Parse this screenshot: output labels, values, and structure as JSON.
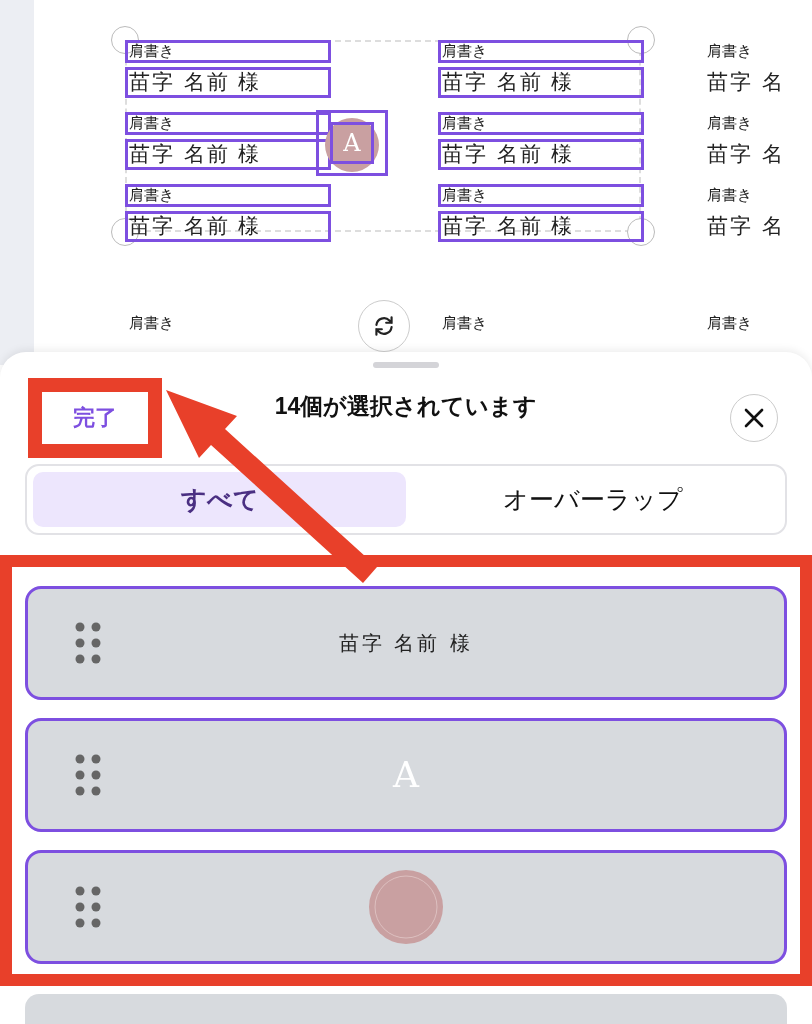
{
  "canvas": {
    "columns": [
      {
        "items": [
          {
            "title": "肩書き",
            "name": "苗字 名前 様",
            "selected": true
          },
          {
            "title": "肩書き",
            "name": "苗字 名前 様",
            "selected": true
          },
          {
            "title": "肩書き",
            "name": "苗字 名前 様",
            "selected": true
          },
          {
            "title": "肩書き",
            "selected": false
          }
        ]
      },
      {
        "items": [
          {
            "title": "肩書き",
            "name": "苗字 名前 様",
            "selected": true
          },
          {
            "title": "肩書き",
            "name": "苗字 名前 様",
            "selected": true
          },
          {
            "title": "肩書き",
            "name": "苗字 名前 様",
            "selected": true
          },
          {
            "title": "肩書き",
            "selected": false
          }
        ]
      },
      {
        "items": [
          {
            "title": "肩書き",
            "name": "苗字 名",
            "selected": false
          },
          {
            "title": "肩書き",
            "name": "苗字 名",
            "selected": false
          },
          {
            "title": "肩書き",
            "name": "苗字 名",
            "selected": false
          },
          {
            "title": "肩書き",
            "selected": false
          }
        ]
      }
    ],
    "emblem": {
      "letter": "A",
      "selected": true
    }
  },
  "sheet": {
    "done": "完了",
    "title": "14個が選択されています",
    "tabs": [
      {
        "label": "すべて",
        "selected": true
      },
      {
        "label": "オーバーラップ",
        "selected": false
      }
    ],
    "layers": [
      {
        "kind": "text",
        "text": "苗字 名前 様",
        "selected": true
      },
      {
        "kind": "letter",
        "text": "A",
        "selected": true
      },
      {
        "kind": "image",
        "selected": true
      },
      {
        "kind": "blank",
        "selected": false
      }
    ]
  }
}
